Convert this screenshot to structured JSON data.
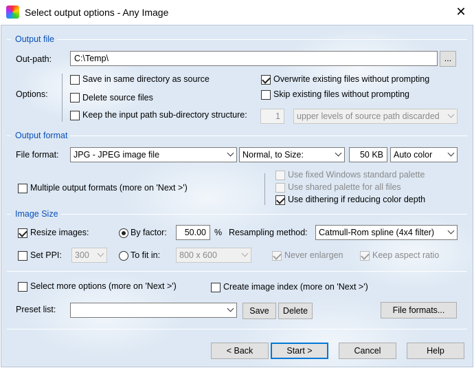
{
  "window": {
    "title": "Select output options - Any Image",
    "close_glyph": "✕"
  },
  "output_file": {
    "section_title": "Output file",
    "outpath_label": "Out-path:",
    "outpath_value": "C:\\Temp\\",
    "browse_label": "...",
    "options_label": "Options:",
    "save_same_dir": "Save in same directory as source",
    "delete_source": "Delete source files",
    "keep_structure": "Keep the input path sub-directory structure:",
    "levels_value": "1",
    "levels_dropdown": "upper levels of source path discarded",
    "overwrite": "Overwrite existing files without prompting",
    "skip_existing": "Skip existing files without prompting"
  },
  "output_format": {
    "section_title": "Output format",
    "file_format_label": "File format:",
    "file_format_value": "JPG - JPEG image file",
    "quality_mode": "Normal, to Size:",
    "size_value": "50 KB",
    "color_mode": "Auto color",
    "multiple_formats": "Multiple output formats (more on 'Next >')",
    "fixed_palette": "Use fixed Windows standard palette",
    "shared_palette": "Use shared palette for all files",
    "dithering": "Use dithering if reducing color depth"
  },
  "image_size": {
    "section_title": "Image Size",
    "resize_images": "Resize images:",
    "by_factor": "By factor:",
    "factor_value": "50.00",
    "percent": "%",
    "resampling_label": "Resampling method:",
    "resampling_value": "Catmull-Rom spline (4x4 filter)",
    "set_ppi": "Set PPI:",
    "ppi_value": "300",
    "to_fit_in": "To fit in:",
    "fit_value": "800 x 600",
    "never_enlarge": "Never enlargen",
    "keep_aspect": "Keep aspect ratio"
  },
  "extras": {
    "more_options": "Select more options (more on 'Next >')",
    "create_index": "Create image index (more on 'Next >')",
    "preset_label": "Preset list:",
    "preset_value": "",
    "save_button": "Save",
    "delete_button": "Delete",
    "file_formats_button": "File formats..."
  },
  "footer": {
    "back": "< Back",
    "start": "Start >",
    "cancel": "Cancel",
    "help": "Help"
  }
}
